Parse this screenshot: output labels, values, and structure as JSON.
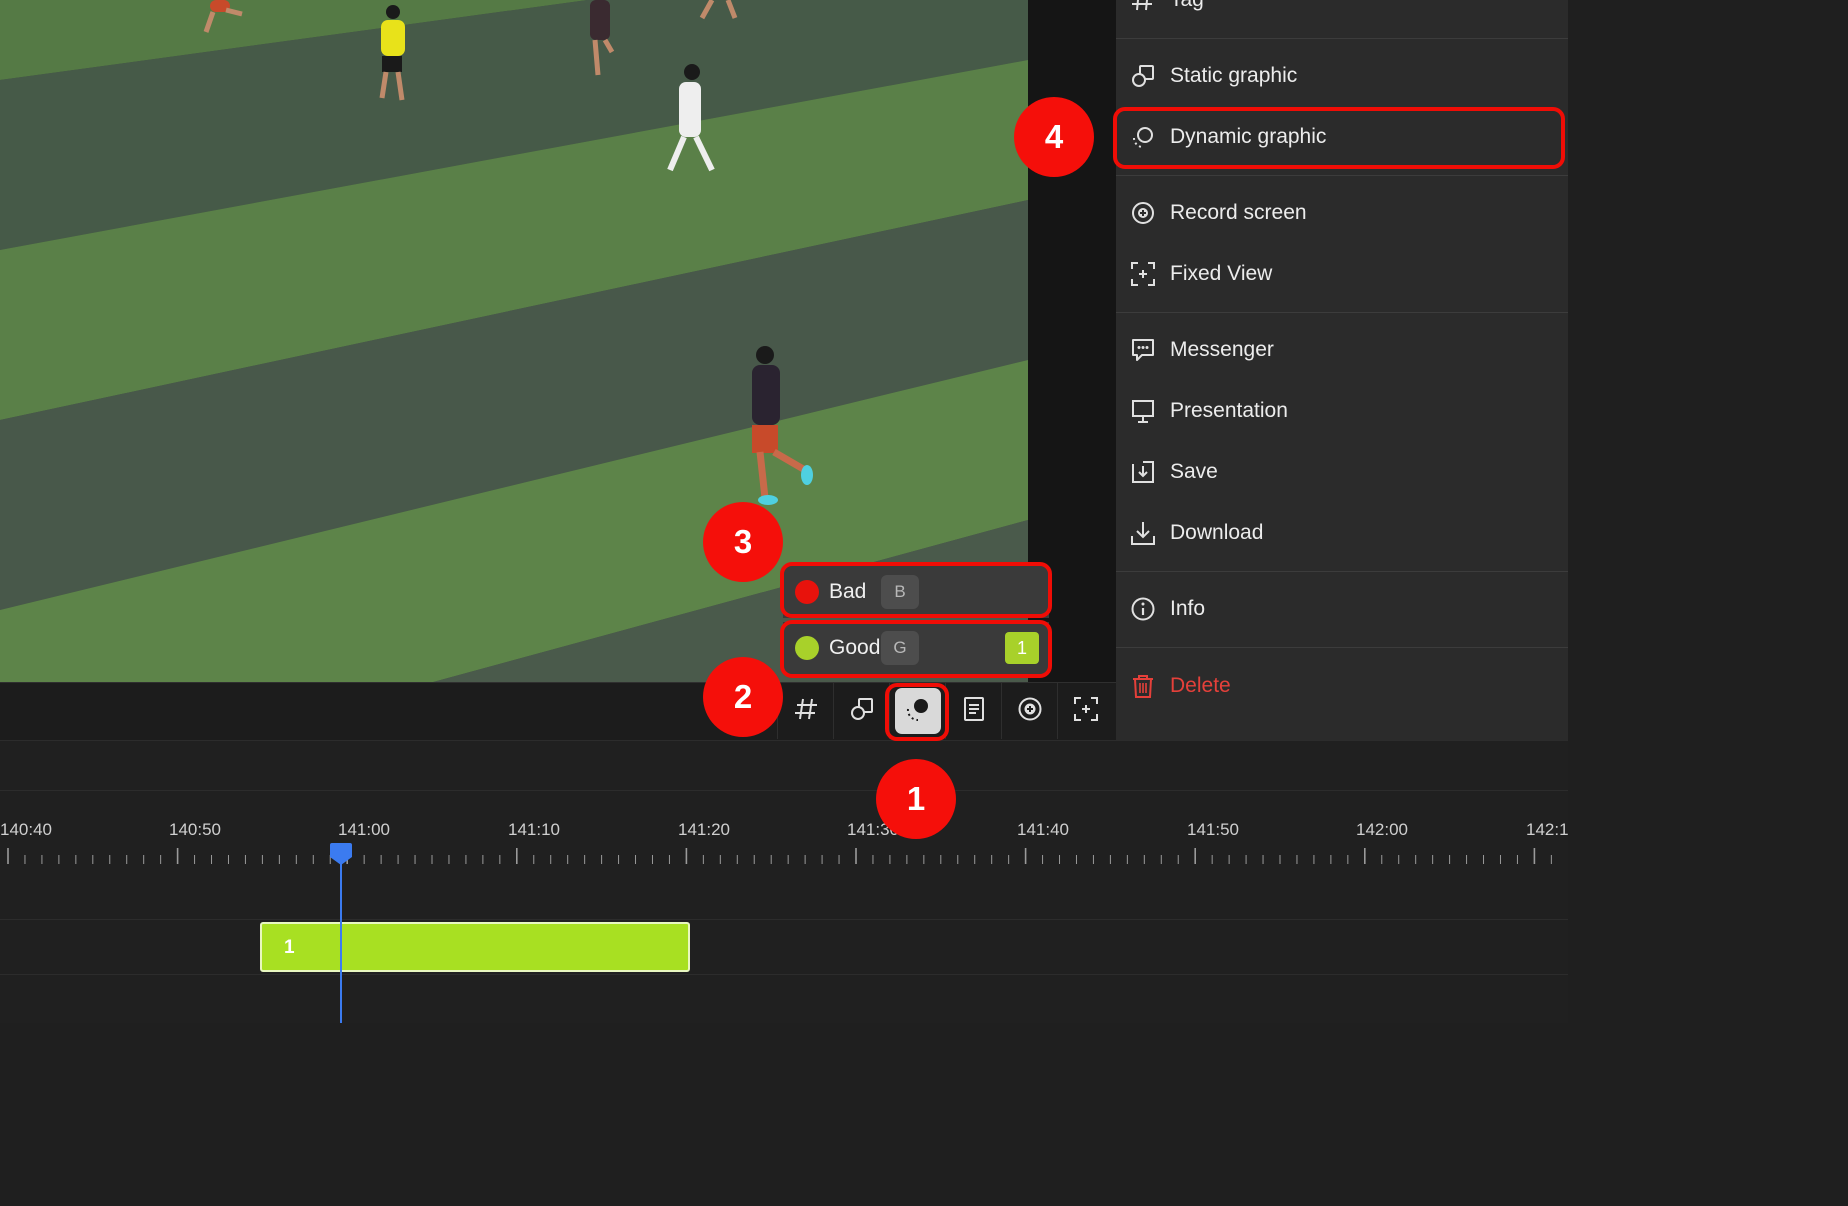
{
  "side_menu": {
    "items": [
      {
        "label": "Tag",
        "icon": "hash-icon"
      },
      {
        "label": "Static graphic",
        "icon": "shapes-icon"
      },
      {
        "label": "Dynamic graphic",
        "icon": "dynamic-graphic-icon"
      },
      {
        "label": "Record screen",
        "icon": "record-icon"
      },
      {
        "label": "Fixed View",
        "icon": "fixed-view-icon"
      },
      {
        "label": "Messenger",
        "icon": "messenger-icon"
      },
      {
        "label": "Presentation",
        "icon": "presentation-icon"
      },
      {
        "label": "Save",
        "icon": "save-icon"
      },
      {
        "label": "Download",
        "icon": "download-icon"
      },
      {
        "label": "Info",
        "icon": "info-icon"
      },
      {
        "label": "Delete",
        "icon": "trash-icon",
        "color": "#e5403a"
      }
    ]
  },
  "toolbar": {
    "buttons": [
      "hash-icon",
      "shapes-icon",
      "dynamic-graphic-icon",
      "notes-icon",
      "record-icon",
      "fixed-view-icon"
    ],
    "active": "dynamic-graphic-icon"
  },
  "tag_popup": {
    "tags": [
      {
        "label": "Bad",
        "key": "B",
        "color": "#e8120c",
        "count": ""
      },
      {
        "label": "Good",
        "key": "G",
        "color": "#a8d12a",
        "count": "1"
      }
    ]
  },
  "timeline": {
    "ticks": [
      "140:40",
      "140:50",
      "141:00",
      "141:10",
      "141:20",
      "141:30",
      "141:40",
      "141:50",
      "142:00",
      "142:1"
    ],
    "clip_label": "1",
    "playhead_color": "#3b7bf0",
    "clip_color": "#a8e022"
  },
  "annotations": {
    "badges": [
      "1",
      "2",
      "3",
      "4"
    ],
    "color": "#f50f0a"
  }
}
